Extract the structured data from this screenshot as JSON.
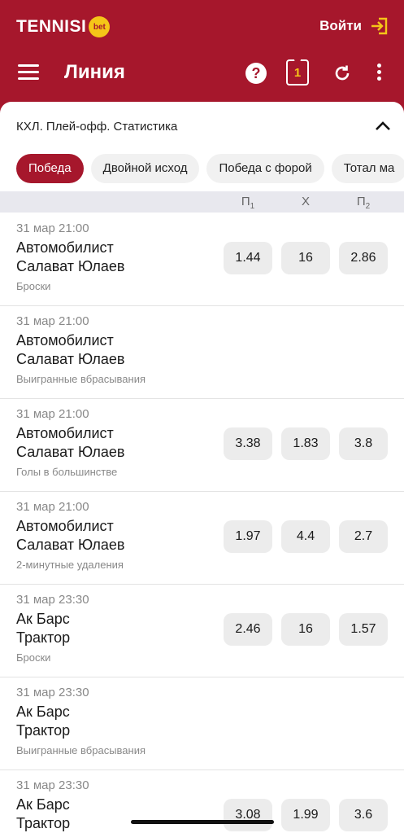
{
  "header": {
    "brand": "TENNISI",
    "brand_badge": "bet",
    "login_label": "Войти",
    "title": "Линия",
    "help_symbol": "?",
    "coupon_count": "1",
    "colors": {
      "brand": "#a6172c",
      "accent": "#f5c518"
    }
  },
  "league": {
    "title": "КХЛ. Плей-офф. Статистика"
  },
  "filters": [
    {
      "label": "Победа",
      "active": true
    },
    {
      "label": "Двойной исход",
      "active": false
    },
    {
      "label": "Победа с форой",
      "active": false
    },
    {
      "label": "Тотал ма",
      "active": false
    }
  ],
  "columns": {
    "p1": "П",
    "p1_sub": "1",
    "x": "X",
    "p2": "П",
    "p2_sub": "2"
  },
  "events": [
    {
      "time": "31 мар 21:00",
      "team1": "Автомобилист",
      "team2": "Салават Юлаев",
      "market": "Броски",
      "odds": [
        "1.44",
        "16",
        "2.86"
      ]
    },
    {
      "time": "31 мар 21:00",
      "team1": "Автомобилист",
      "team2": "Салават Юлаев",
      "market": "Выигранные вбрасывания",
      "odds": []
    },
    {
      "time": "31 мар 21:00",
      "team1": "Автомобилист",
      "team2": "Салават Юлаев",
      "market": "Голы в большинстве",
      "odds": [
        "3.38",
        "1.83",
        "3.8"
      ]
    },
    {
      "time": "31 мар 21:00",
      "team1": "Автомобилист",
      "team2": "Салават Юлаев",
      "market": "2-минутные удаления",
      "odds": [
        "1.97",
        "4.4",
        "2.7"
      ]
    },
    {
      "time": "31 мар 23:30",
      "team1": "Ак Барс",
      "team2": "Трактор",
      "market": "Броски",
      "odds": [
        "2.46",
        "16",
        "1.57"
      ]
    },
    {
      "time": "31 мар 23:30",
      "team1": "Ак Барс",
      "team2": "Трактор",
      "market": "Выигранные вбрасывания",
      "odds": []
    },
    {
      "time": "31 мар 23:30",
      "team1": "Ак Барс",
      "team2": "Трактор",
      "market": "",
      "odds": [
        "3.08",
        "1.99",
        "3.6"
      ]
    }
  ]
}
